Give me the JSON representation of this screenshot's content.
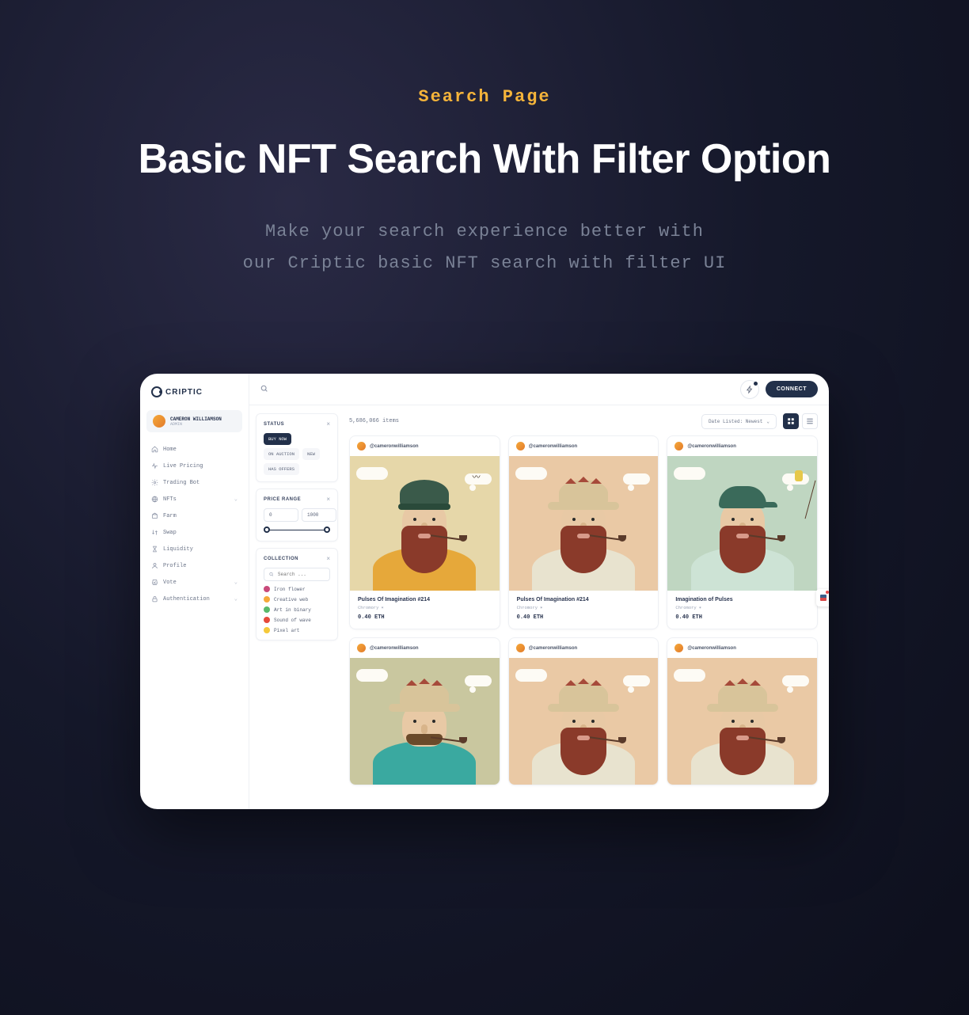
{
  "hero": {
    "eyebrow": "Search Page",
    "title": "Basic NFT Search With Filter Option",
    "subtitle_l1": "Make your search experience better with",
    "subtitle_l2": "our Criptic basic NFT search with filter UI"
  },
  "app": {
    "logo": "CRIPTIC",
    "user": {
      "name": "CAMERON WILLIAMSON",
      "role": "ADMIN"
    },
    "nav": [
      {
        "label": "Home",
        "icon": "home"
      },
      {
        "label": "Live Pricing",
        "icon": "pulse"
      },
      {
        "label": "Trading Bot",
        "icon": "gear"
      },
      {
        "label": "NFTs",
        "icon": "globe",
        "expandable": true
      },
      {
        "label": "Farm",
        "icon": "farm"
      },
      {
        "label": "Swap",
        "icon": "swap"
      },
      {
        "label": "Liquidity",
        "icon": "hourglass"
      },
      {
        "label": "Profile",
        "icon": "profile"
      },
      {
        "label": "Vote",
        "icon": "vote",
        "expandable": true
      },
      {
        "label": "Authentication",
        "icon": "lock",
        "expandable": true
      }
    ],
    "connect": "CONNECT",
    "filters": {
      "status": {
        "title": "STATUS",
        "chips": [
          {
            "label": "BUY NOW",
            "active": true
          },
          {
            "label": "ON AUCTION",
            "active": false
          },
          {
            "label": "NEW",
            "active": false
          },
          {
            "label": "HAS OFFERS",
            "active": false
          }
        ]
      },
      "price": {
        "title": "PRICE RANGE",
        "min": "0",
        "max": "1000"
      },
      "collection": {
        "title": "COLLECTION",
        "search_placeholder": "Search ...",
        "items": [
          {
            "label": "Iron flower",
            "color": "#c94a7a"
          },
          {
            "label": "Creative web",
            "color": "#f5a93a"
          },
          {
            "label": "Art in binary",
            "color": "#5ab96a"
          },
          {
            "label": "Sound of wave",
            "color": "#e64a3a"
          },
          {
            "label": "Pixel art",
            "color": "#f5c93a"
          }
        ]
      }
    },
    "grid": {
      "count": "5,686,066 items",
      "sort": "Date Listed: Newest",
      "cards": [
        {
          "user": "@cameronwilliamson",
          "title": "Pulses Of Imagination #214",
          "sub": "Chromory",
          "price": "0.40 ETH",
          "variant": "a"
        },
        {
          "user": "@cameronwilliamson",
          "title": "Pulses Of Imagination #214",
          "sub": "Chromory",
          "price": "0.40 ETH",
          "variant": "b"
        },
        {
          "user": "@cameronwilliamson",
          "title": "Imagination of Pulses",
          "sub": "Chromory",
          "price": "0.40 ETH",
          "variant": "c"
        },
        {
          "user": "@cameronwilliamson",
          "variant": "d"
        },
        {
          "user": "@cameronwilliamson",
          "variant": "b"
        },
        {
          "user": "@cameronwilliamson",
          "variant": "b"
        }
      ]
    }
  }
}
